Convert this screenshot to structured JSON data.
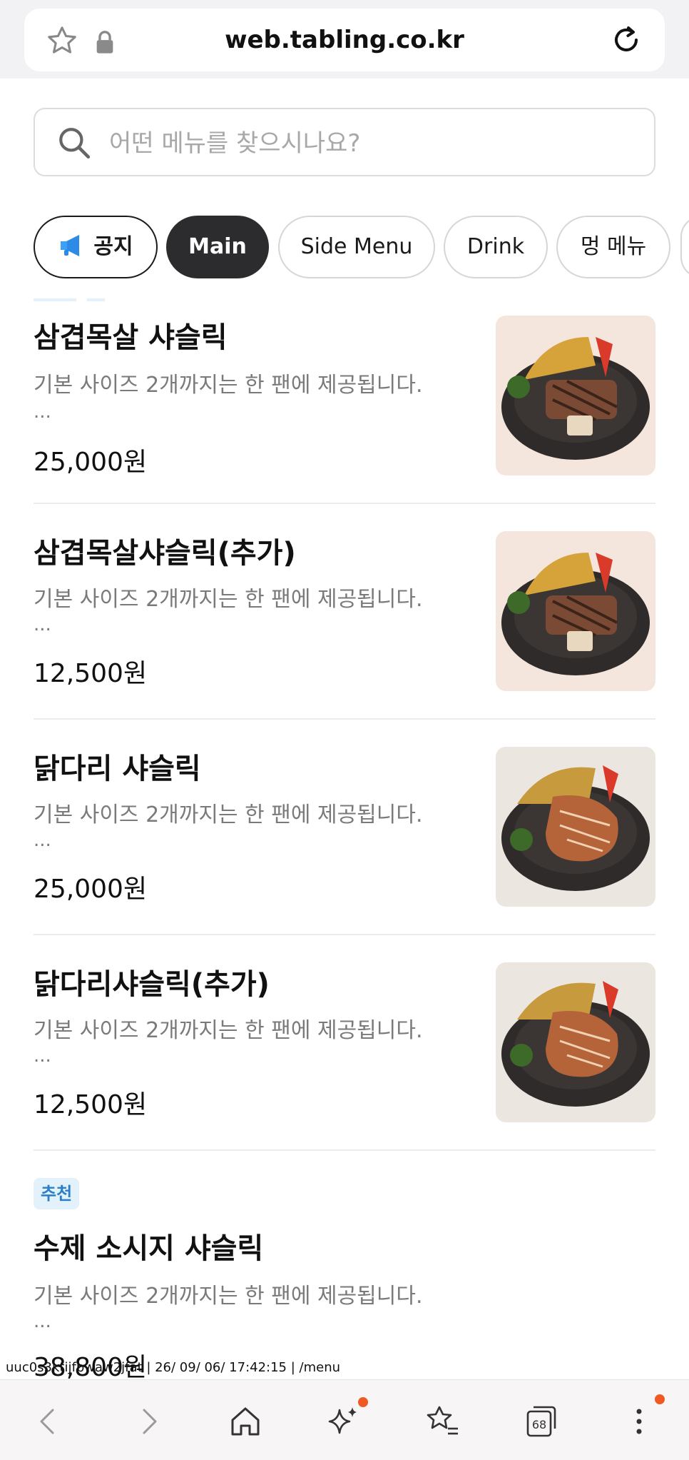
{
  "browser": {
    "url": "web.tabling.co.kr"
  },
  "search": {
    "placeholder": "어떤 메뉴를 찾으시나요?"
  },
  "tabs": [
    {
      "label": "공지",
      "active": false
    },
    {
      "label": "Main",
      "active": true
    },
    {
      "label": "Side Menu",
      "active": false
    },
    {
      "label": "Drink",
      "active": false
    },
    {
      "label": "멍 메뉴",
      "active": false
    }
  ],
  "menu": [
    {
      "name": "삼겹목살 샤슬릭",
      "desc": "기본 사이즈 2개까지는 한 팬에 제공됩니다.",
      "more": "...",
      "price": "25,000원"
    },
    {
      "name": "삼겹목살샤슬릭(추가)",
      "desc": "기본 사이즈 2개까지는 한 팬에 제공됩니다.",
      "more": "...",
      "price": "12,500원"
    },
    {
      "name": "닭다리 샤슬릭",
      "desc": "기본 사이즈 2개까지는 한 팬에 제공됩니다.",
      "more": "...",
      "price": "25,000원"
    },
    {
      "name": "닭다리샤슬릭(추가)",
      "desc": "기본 사이즈 2개까지는 한 팬에 제공됩니다.",
      "more": "...",
      "price": "12,500원"
    },
    {
      "badge": "추천",
      "name": "수제 소시지 샤슬릭",
      "desc": "기본 사이즈 2개까지는 한 팬에 제공됩니다.",
      "more": "...",
      "price": "38,800원"
    }
  ],
  "overlay_text": "uuc0s3ktijfbwaw2jfat | 26/ 09/ 06/ 17:42:15 | /menu",
  "toolbar": {
    "tab_count": "68",
    "icons": [
      "back-icon",
      "forward-icon",
      "home-icon",
      "sparkle-icon",
      "bookmarks-icon",
      "tabs-icon",
      "more-icon"
    ]
  },
  "colors": {
    "active_tab": "#2c2c2e",
    "badge_bg": "#e3f1fb",
    "badge_text": "#2a7fc8",
    "notification_dot": "#f05a22"
  }
}
